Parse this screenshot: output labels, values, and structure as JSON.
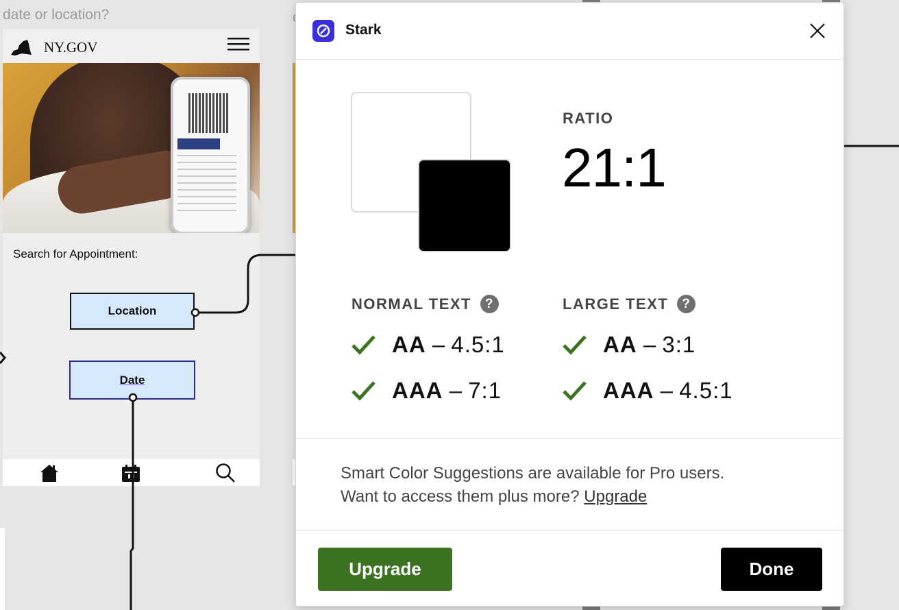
{
  "canvas": {
    "prompt_title": "date or location?",
    "fragment_text": "c"
  },
  "mobile_frame": {
    "brand": "NY.GOV",
    "search_label": "Search for Appointment:",
    "location_button": "Location",
    "date_button": "Date",
    "tabbar": [
      "home-icon",
      "calendar-icon",
      "search-icon"
    ]
  },
  "stark": {
    "title": "Stark",
    "ratio_label": "RATIO",
    "ratio_value": "21:1",
    "foreground_color": "#000000",
    "background_color": "#FFFFFF",
    "normal_text": {
      "heading": "NORMAL TEXT",
      "aa": {
        "level": "AA",
        "sep": " – ",
        "threshold": "4.5:1",
        "pass": true
      },
      "aaa": {
        "level": "AAA",
        "sep": " – ",
        "threshold": "7:1",
        "pass": true
      }
    },
    "large_text": {
      "heading": "LARGE TEXT",
      "aa": {
        "level": "AA",
        "sep": " – ",
        "threshold": "3:1",
        "pass": true
      },
      "aaa": {
        "level": "AAA",
        "sep": " – ",
        "threshold": "4.5:1",
        "pass": true
      }
    },
    "pro_message_line1": "Smart Color Suggestions are available for Pro users.",
    "pro_message_line2": "Want to access them plus more? ",
    "pro_link": "Upgrade",
    "upgrade_button": "Upgrade",
    "done_button": "Done",
    "colors": {
      "brand": "#3B2FD9",
      "upgrade": "#3B7322",
      "pass_check": "#3B7322"
    }
  }
}
